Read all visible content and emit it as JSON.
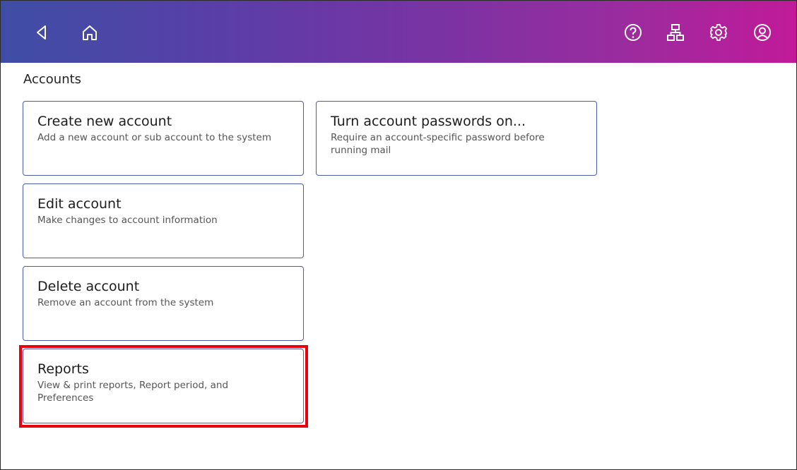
{
  "header": {
    "icons": {
      "back": "back-icon",
      "home": "home-icon",
      "help": "help-icon",
      "network": "network-icon",
      "settings": "gear-icon",
      "account": "user-icon"
    },
    "gradient_start": "#3e4ea6",
    "gradient_end": "#c11a99"
  },
  "page": {
    "title": "Accounts"
  },
  "cards": {
    "create": {
      "title": "Create new account",
      "description": "Add a new account or sub account to the system"
    },
    "passwords": {
      "title": "Turn account passwords on...",
      "description": "Require an account-specific password before running mail"
    },
    "edit": {
      "title": "Edit account",
      "description": "Make changes to account information"
    },
    "delete": {
      "title": "Delete account",
      "description": "Remove an account from the system"
    },
    "reports": {
      "title": "Reports",
      "description": "View & print reports, Report period, and Preferences",
      "highlighted": true
    }
  },
  "colors": {
    "card_border": "#4a5fa8",
    "highlight": "#e8000b"
  }
}
